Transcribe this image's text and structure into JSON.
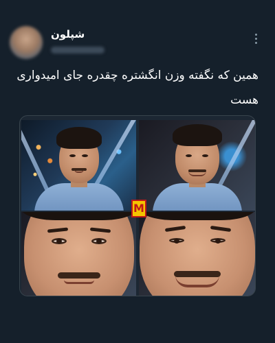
{
  "tweet": {
    "display_name": "شپلون",
    "text": "همین که نگفته وزن انگشتره چقدره جای امیدواری هست",
    "more_icon": "more-vertical-icon",
    "avatar_icon": "avatar-blurred"
  },
  "media": {
    "logo_text": "M",
    "logo_colors": {
      "background": "#f5c400",
      "border": "#c01818",
      "text": "#c01818"
    },
    "panel_count": 4
  },
  "colors": {
    "background": "#15202b",
    "text": "#ffffff",
    "secondary": "#8899a6",
    "border": "#38444d"
  }
}
